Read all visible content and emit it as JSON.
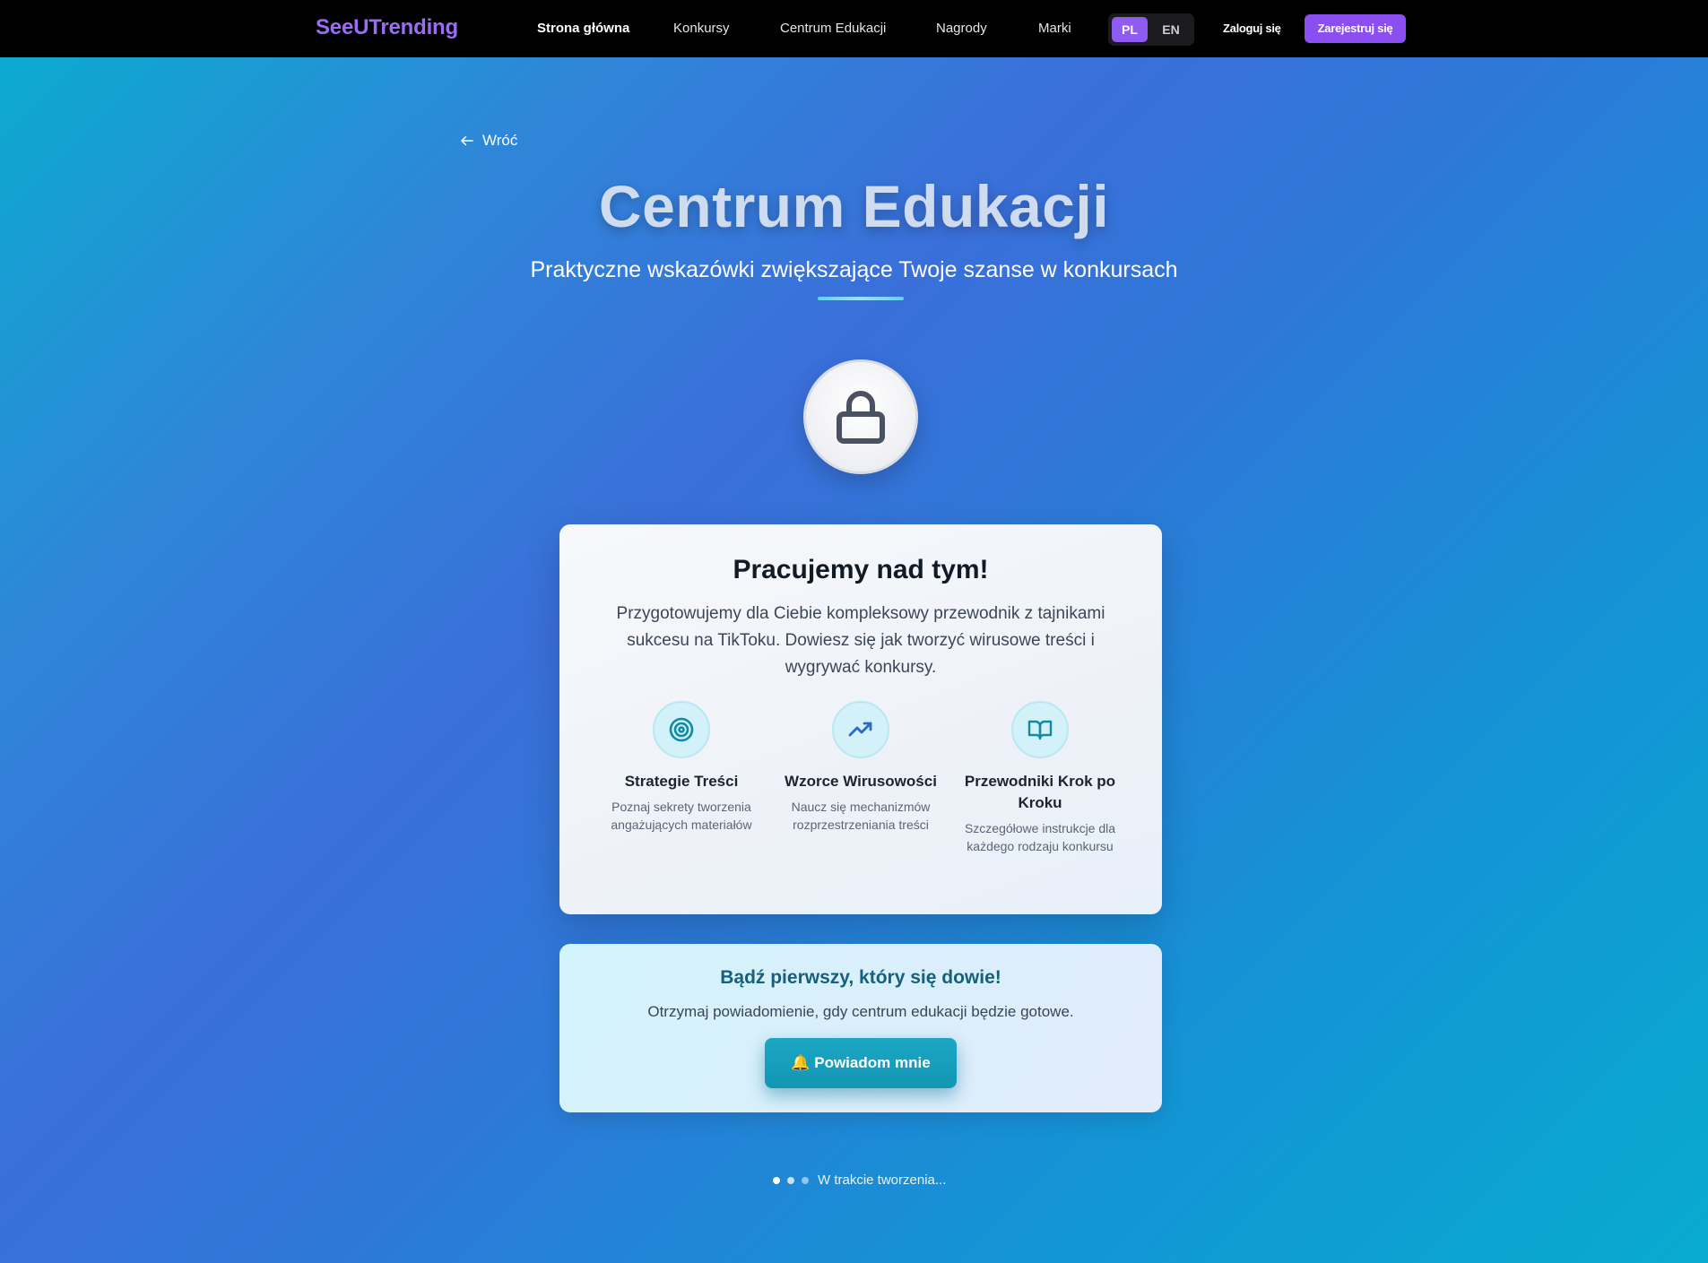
{
  "header": {
    "brand": "SeeUTrending",
    "nav": [
      {
        "label": "Strona główna",
        "active": true
      },
      {
        "label": "Konkursy",
        "active": false
      },
      {
        "label": "Centrum Edukacji",
        "active": false
      },
      {
        "label": "Nagrody",
        "active": false
      },
      {
        "label": "Marki",
        "active": false
      }
    ],
    "languages": {
      "selected": "PL",
      "options": [
        "PL",
        "EN"
      ]
    },
    "login_label": "Zaloguj się",
    "register_label": "Zarejestruj się"
  },
  "back_label": "Wróć",
  "hero": {
    "title": "Centrum Edukacji",
    "subtitle": "Praktyczne wskazówki zwiększające Twoje szanse w konkursach"
  },
  "lock_icon": "lock-icon",
  "card": {
    "title": "Pracujemy nad tym!",
    "text": "Przygotowujemy dla Ciebie kompleksowy przewodnik z tajnikami sukcesu na TikToku. Dowiesz się jak tworzyć wirusowe treści i wygrywać konkursy.",
    "features": [
      {
        "icon": "target-icon",
        "title": "Strategie Treści",
        "desc": "Poznaj sekrety tworzenia angażujących materiałów"
      },
      {
        "icon": "trending-up-icon",
        "title": "Wzorce Wirusowości",
        "desc": "Naucz się mechanizmów rozprzestrzeniania treści"
      },
      {
        "icon": "book-open-icon",
        "title": "Przewodniki Krok po Kroku",
        "desc": "Szczegółowe instrukcje dla każdego rodzaju konkursu"
      }
    ]
  },
  "notify": {
    "title": "Bądź pierwszy, który się dowie!",
    "text": "Otrzymaj powiadomienie, gdy centrum edukacji będzie gotowe.",
    "button_label": "🔔 Powiadom mnie"
  },
  "status_text": "W trakcie tworzenia...",
  "colors": {
    "brand": "#9b6cf5",
    "accent_purple": "#8b4ff1",
    "teal_button": "#1296b4",
    "notify_title": "#16607a"
  }
}
